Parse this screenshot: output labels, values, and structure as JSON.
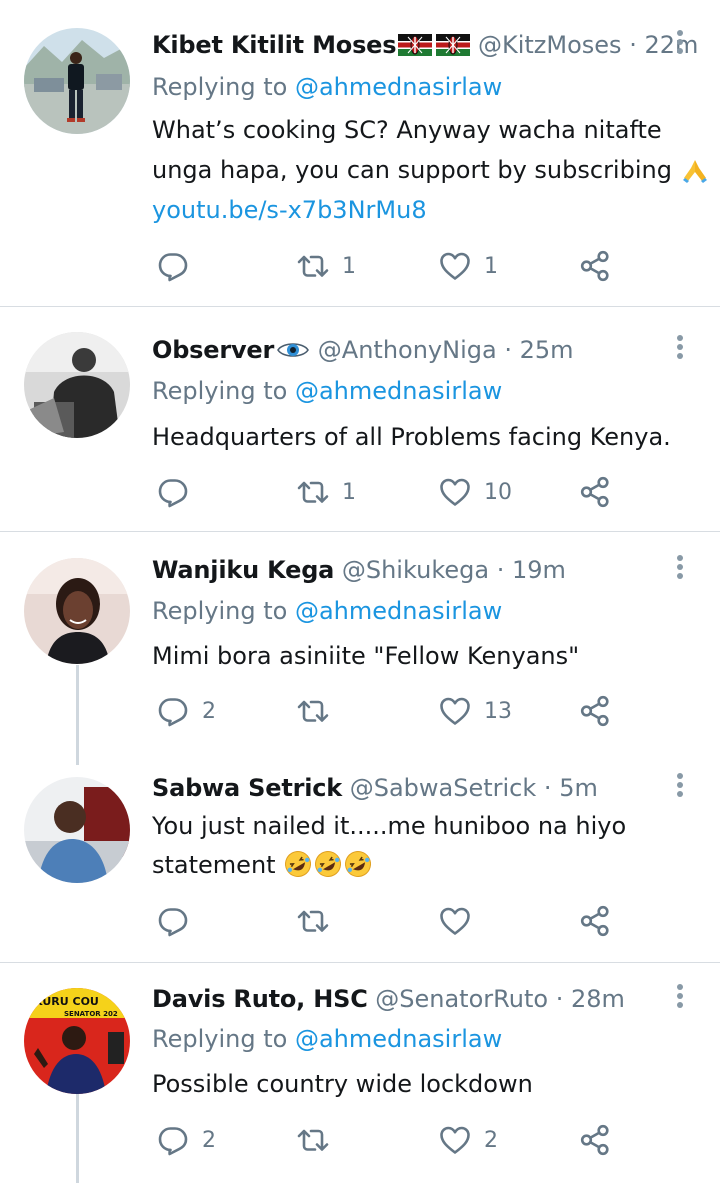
{
  "tweets": [
    {
      "name": "Kibet Kitilit Moses",
      "handle": "@KitzMoses",
      "time": "22m",
      "replying_prefix": "Replying to",
      "replying_to": "@ahmednasirlaw",
      "lines": [
        "What’s cooking SC? Anyway wacha nitafte",
        "unga hapa, you can support by subscribing"
      ],
      "link": "youtu.be/s-x7b3NrMu8",
      "reply_count": "",
      "retweet_count": "1",
      "like_count": "1"
    },
    {
      "name": "Observer",
      "handle": "@AnthonyNiga",
      "time": "25m",
      "replying_prefix": "Replying to",
      "replying_to": "@ahmednasirlaw",
      "lines": [
        "Headquarters of  all Problems facing Kenya."
      ],
      "reply_count": "",
      "retweet_count": "1",
      "like_count": "10"
    },
    {
      "name": "Wanjiku Kega",
      "handle": "@Shikukega",
      "time": "19m",
      "replying_prefix": "Replying to",
      "replying_to": "@ahmednasirlaw",
      "lines": [
        "Mimi bora asiniite \"Fellow Kenyans\""
      ],
      "reply_count": "2",
      "retweet_count": "",
      "like_count": "13"
    },
    {
      "name": "Sabwa Setrick",
      "handle": "@SabwaSetrick",
      "time": "5m",
      "lines": [
        "You just nailed it.....me huniboo na hiyo",
        "statement"
      ],
      "reply_count": "",
      "retweet_count": "",
      "like_count": ""
    },
    {
      "name": "Davis Ruto, HSC",
      "handle": "@SenatorRuto",
      "time": "28m",
      "replying_prefix": "Replying to",
      "replying_to": "@ahmednasirlaw",
      "lines": [
        "Possible country wide lockdown"
      ],
      "avatar_text": [
        "KURU COU",
        "SENATOR 202"
      ],
      "reply_count": "2",
      "retweet_count": "",
      "like_count": "2"
    }
  ],
  "colors": {
    "link": "#1b95e0",
    "secondary_text": "#657786",
    "primary_text": "#14171a",
    "separator": "#d8dde2",
    "thread_line": "#cfd7de"
  },
  "icons": [
    "reply-icon",
    "retweet-icon",
    "like-icon",
    "share-icon",
    "more-icon",
    "kenya-flag-icon",
    "eye-icon",
    "folded-hands-emoji",
    "rofl-emoji"
  ]
}
